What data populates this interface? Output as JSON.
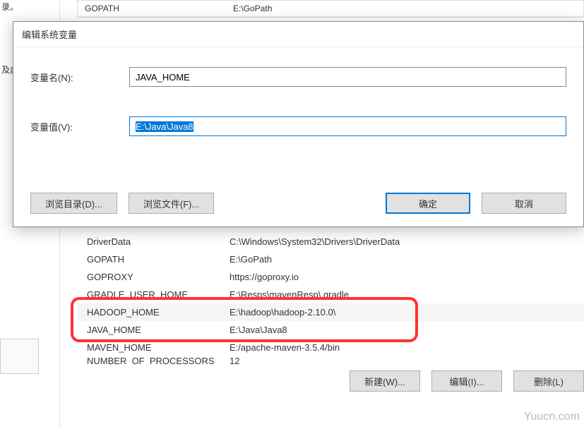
{
  "bg": {
    "sidebar_label1": "录。",
    "sidebar_label2": "及虚拟",
    "top_rows": [
      {
        "name": "GOPATH",
        "value": "E:\\GoPath"
      }
    ]
  },
  "modal": {
    "title": "编辑系统变量",
    "name_label": "变量名(N):",
    "value_label": "变量值(V):",
    "name_value": "JAVA_HOME",
    "value_value": "E:\\Java\\Java8",
    "browse_dir": "浏览目录(D)...",
    "browse_file": "浏览文件(F)...",
    "ok": "确定",
    "cancel": "取消"
  },
  "env_rows": [
    {
      "name": "DriverData",
      "value": "C:\\Windows\\System32\\Drivers\\DriverData"
    },
    {
      "name": "GOPATH",
      "value": "E:\\GoPath"
    },
    {
      "name": "GOPROXY",
      "value": "https://goproxy.io"
    },
    {
      "name": "GRADLE_USER_HOME",
      "value": "E:\\Resps\\mavenResp\\.gradle"
    },
    {
      "name": "HADOOP_HOME",
      "value": "E:\\hadoop\\hadoop-2.10.0\\"
    },
    {
      "name": "JAVA_HOME",
      "value": "E:\\Java\\Java8"
    },
    {
      "name": "MAVEN_HOME",
      "value": "E:/apache-maven-3.5.4/bin"
    },
    {
      "name": "NUMBER_OF_PROCESSORS",
      "value": "12"
    }
  ],
  "lower_buttons": {
    "new": "新建(W)...",
    "edit": "编辑(I)...",
    "delete": "删除(L)"
  },
  "watermark": "Yuucn.com"
}
